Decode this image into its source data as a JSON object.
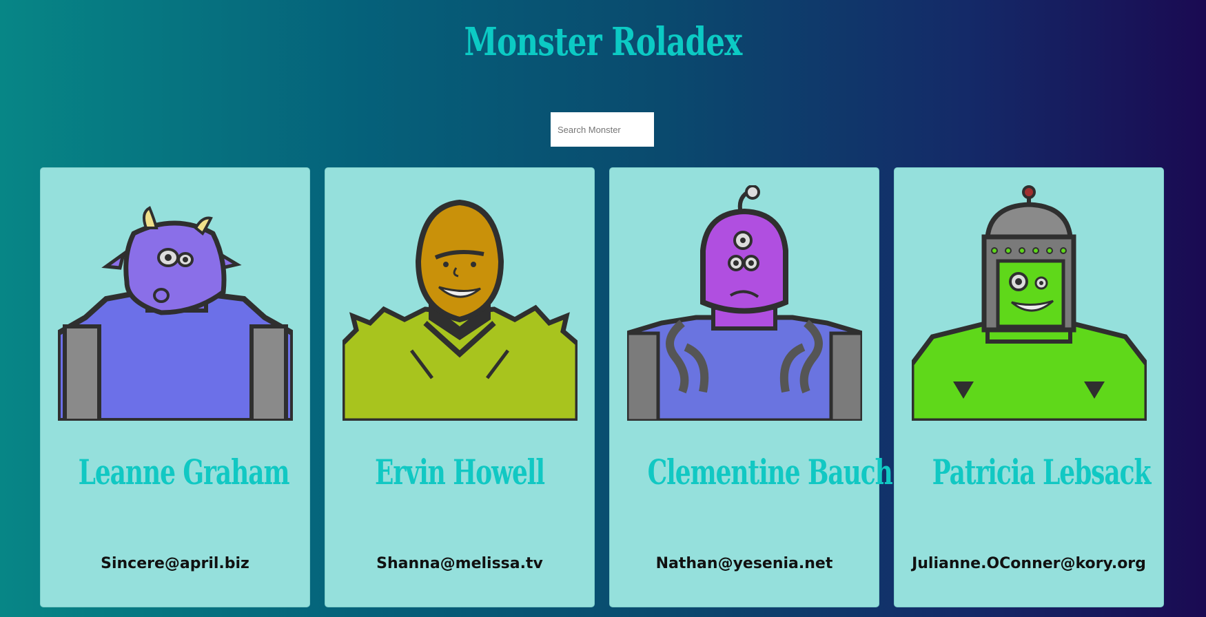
{
  "app": {
    "title": "Monster Roladex"
  },
  "search": {
    "placeholder": "Search Monster",
    "value": ""
  },
  "monsters": [
    {
      "name": "Leanne Graham",
      "email": "Sincere@april.biz",
      "color": "#8a6fe8"
    },
    {
      "name": "Ervin Howell",
      "email": "Shanna@melissa.tv",
      "color": "#c9d61a"
    },
    {
      "name": "Clementine Bauch",
      "email": "Nathan@yesenia.net",
      "color": "#b04fe0"
    },
    {
      "name": "Patricia Lebsack",
      "email": "Julianne.OConner@kory.org",
      "color": "#5fd81a"
    }
  ],
  "colors": {
    "title": "#0ccac4",
    "card_bg": "#95e0dc",
    "name": "#11c8c3"
  }
}
